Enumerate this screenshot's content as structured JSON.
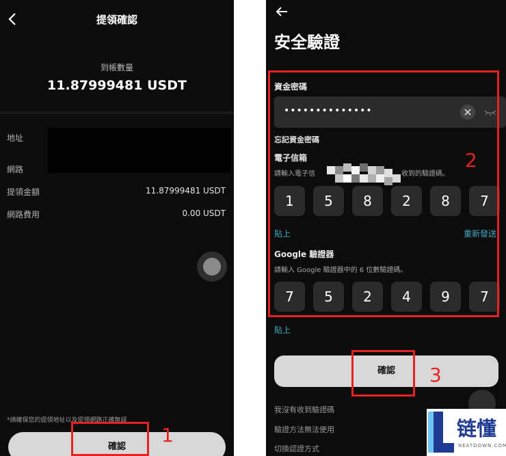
{
  "left": {
    "title": "提領確認",
    "amount_label": "到帳數量",
    "amount_value": "11.87999481 USDT",
    "address_label": "地址",
    "network_label": "網路",
    "withdraw_amount_label": "提領金額",
    "withdraw_amount_value": "11.87999481 USDT",
    "fee_label": "網路費用",
    "fee_value": "0.00 USDT",
    "note": "*請確保您的提領地址以及提領網路正確無誤",
    "confirm_label": "確認"
  },
  "right": {
    "title": "安全驗證",
    "fund_password_label": "資金密碼",
    "fund_password_value": "••••••••••••••",
    "forgot_password": "忘記資金密碼",
    "email_label": "電子信箱",
    "email_hint_prefix": "請輸入電子信",
    "email_hint_suffix": "收到的驗證碼。",
    "email_code": [
      "1",
      "5",
      "8",
      "2",
      "8",
      "7"
    ],
    "paste_label": "貼上",
    "resend_label": "重新發送",
    "google_label": "Google 驗證器",
    "google_hint": "請輸入 Google 驗證器中的 6 位數驗證碼。",
    "google_code": [
      "7",
      "5",
      "2",
      "4",
      "9",
      "7"
    ],
    "paste2_label": "貼上",
    "confirm_label": "確認",
    "footer_links": [
      "我沒有收到驗證碼",
      "驗證方法無法使用",
      "切換認證方式"
    ]
  },
  "annotations": [
    "1",
    "2",
    "3"
  ],
  "watermark": {
    "text": "链懂",
    "sub": "NEATDOWN.COM"
  },
  "colors": {
    "background": "#0c0c0c",
    "input_bg": "#2b2b2b",
    "link": "#3fa9c4",
    "annotation": "#e82020",
    "button": "#d8d8d8"
  }
}
